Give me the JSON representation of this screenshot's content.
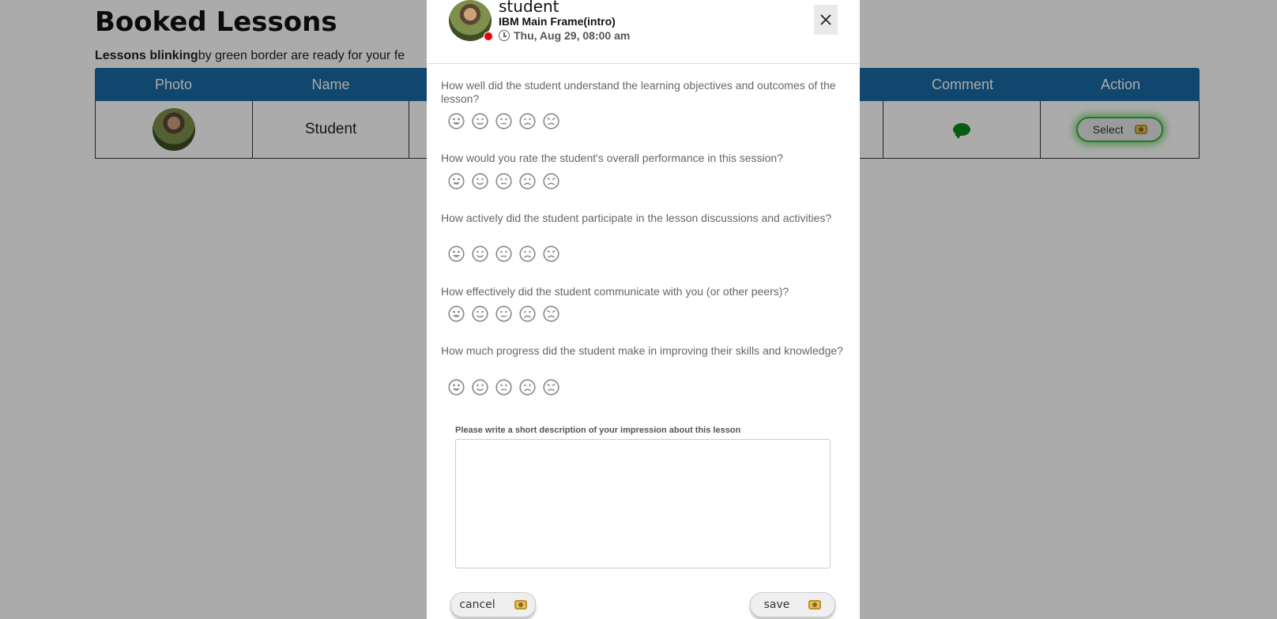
{
  "page": {
    "title": "Booked Lessons",
    "notice_bold": "Lessons blinking",
    "notice_rest": "by green border are ready for your fe"
  },
  "table": {
    "headers": [
      "Photo",
      "Name",
      "",
      "Comment",
      "Action"
    ],
    "row": {
      "name": "Student",
      "action_label": "Select"
    }
  },
  "modal": {
    "username": "student",
    "course": "IBM Main Frame(intro)",
    "datetime": "Thu, Aug 29, 08:00 am",
    "questions": [
      "How well did the student understand the learning objectives and outcomes of the lesson?",
      "How would you rate the student's overall performance in this session?",
      "How actively did the student participate in the lesson discussions and activities?",
      "How effectively did the student communicate with you (or other peers)?",
      "How much progress did the student make in improving their skills and knowledge?"
    ],
    "rating_faces": [
      "grinning-face-icon",
      "smiling-face-icon",
      "neutral-face-icon",
      "frowning-face-icon",
      "angry-face-icon"
    ],
    "description_label": "Please write a short description of your impression about this lesson",
    "description_value": "",
    "cancel_label": "cancel",
    "save_label": "save"
  },
  "colors": {
    "table_header": "#1a6aa5",
    "blink_border": "#3cb043",
    "comment_icon": "#0b8a1e",
    "status_dot": "#ee0000",
    "face_gray": "#888888"
  }
}
